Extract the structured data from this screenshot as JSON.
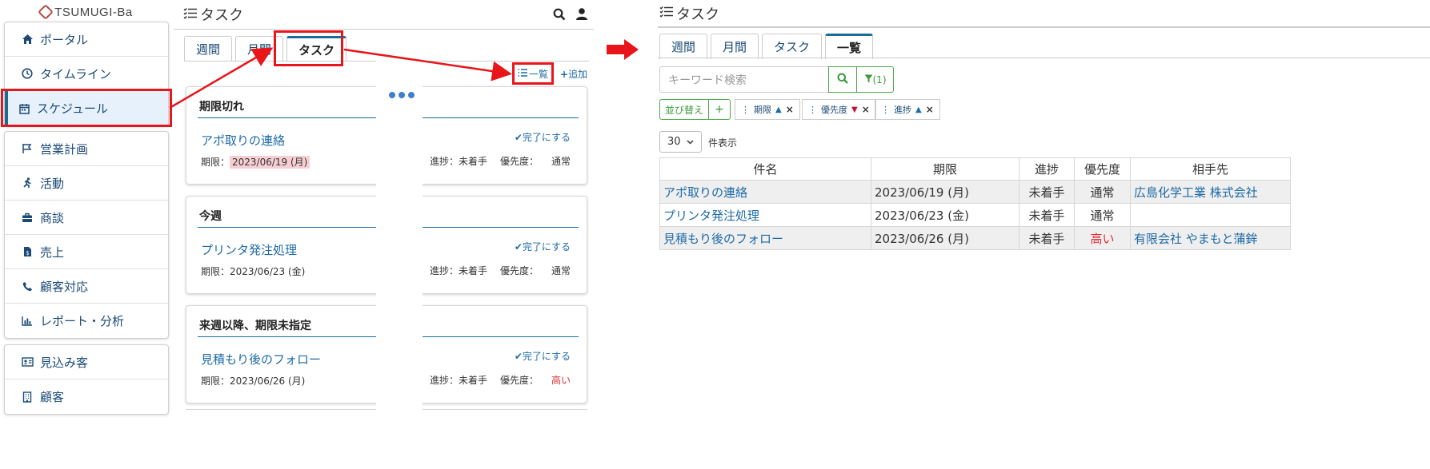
{
  "brand": {
    "logo_text": "TSUMUGI-Ba"
  },
  "sidebar": {
    "group1": [
      {
        "label": "ポータル",
        "icon": "home-icon"
      },
      {
        "label": "タイムライン",
        "icon": "clock-icon"
      },
      {
        "label": "スケジュール",
        "icon": "calendar-icon"
      }
    ],
    "group2": [
      {
        "label": "営業計画",
        "icon": "flag-icon"
      },
      {
        "label": "活動",
        "icon": "running-icon"
      },
      {
        "label": "商談",
        "icon": "briefcase-icon"
      },
      {
        "label": "売上",
        "icon": "receipt-icon"
      },
      {
        "label": "顧客対応",
        "icon": "phone-icon"
      },
      {
        "label": "レポート・分析",
        "icon": "chart-icon"
      }
    ],
    "group3": [
      {
        "label": "見込み客",
        "icon": "id-card-icon"
      },
      {
        "label": "顧客",
        "icon": "building-icon"
      }
    ]
  },
  "mid": {
    "title": "タスク",
    "tabs": [
      "週間",
      "月間",
      "タスク"
    ],
    "list_label": "一覧",
    "add_label": "追加",
    "sections": [
      {
        "title": "期限切れ",
        "task": "アポ取りの連絡",
        "deadline_label": "期限：",
        "deadline": "2023/06/19 (月)",
        "done": "完了にする",
        "progress": "進捗：未着手",
        "priority_label": "優先度：",
        "priority": "通常"
      },
      {
        "title": "今週",
        "task": "プリンタ発注処理",
        "deadline_label": "期限：",
        "deadline": "2023/06/23 (金)",
        "done": "完了にする",
        "progress": "進捗：未着手",
        "priority_label": "優先度：",
        "priority": "通常"
      },
      {
        "title": "来週以降、期限未指定",
        "task": "見積もり後のフォロー",
        "deadline_label": "期限：",
        "deadline": "2023/06/26 (月)",
        "done": "完了にする",
        "progress": "進捗：未着手",
        "priority_label": "優先度：",
        "priority": "高い"
      }
    ]
  },
  "right": {
    "title": "タスク",
    "tabs": [
      "週間",
      "月間",
      "タスク",
      "一覧"
    ],
    "search_placeholder": "キーワード検索",
    "filter_count": "(1)",
    "sort_label": "並び替え",
    "sort_chips": [
      "期限",
      "優先度",
      "進捗"
    ],
    "per_page_value": "30",
    "per_page_label": "件表示",
    "columns": [
      "件名",
      "期限",
      "進捗",
      "優先度",
      "相手先"
    ],
    "rows": [
      {
        "name": "アポ取りの連絡",
        "deadline": "2023/06/19 (月)",
        "progress": "未着手",
        "priority": "通常",
        "partner": "広島化学工業 株式会社"
      },
      {
        "name": "プリンタ発注処理",
        "deadline": "2023/06/23 (金)",
        "progress": "未着手",
        "priority": "通常",
        "partner": ""
      },
      {
        "name": "見積もり後のフォロー",
        "deadline": "2023/06/26 (月)",
        "progress": "未着手",
        "priority": "高い",
        "partner": "有限会社 やまもと蒲鉾"
      }
    ]
  },
  "colors": {
    "accent": "#1b6b9a",
    "link": "#1e6aa6",
    "highlight_red": "#e8151b",
    "overdue_bg": "#f7cfd3",
    "success": "#3a9a3a"
  }
}
